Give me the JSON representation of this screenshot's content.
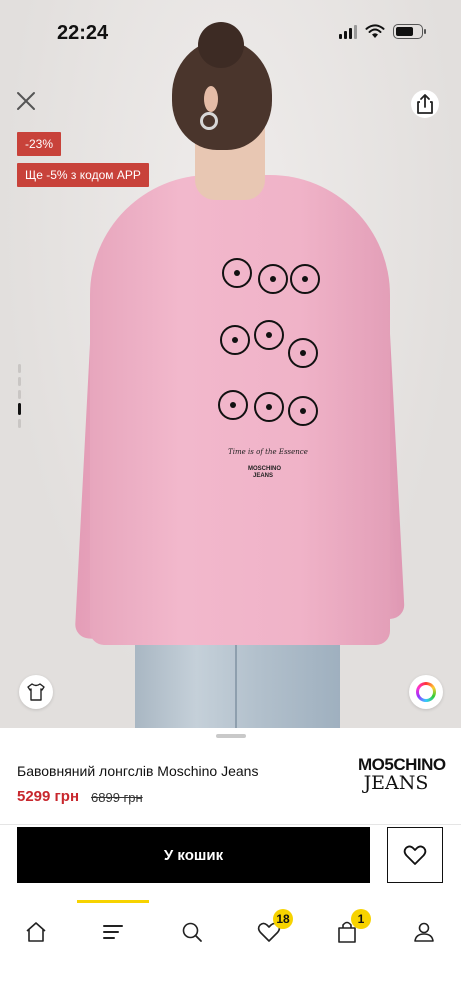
{
  "status_bar": {
    "time": "22:24",
    "signal_icon": "cellular-signal-icon",
    "wifi_icon": "wifi-icon",
    "battery_icon": "battery-icon"
  },
  "gallery": {
    "image_icon": "product-photo",
    "close_icon": "close-icon",
    "share_icon": "share-icon",
    "discount_badge": "-23%",
    "app_promo_badge": "Ще -5% з кодом APP",
    "pagination_count": 5,
    "active_index": 3,
    "tee_icon": "t-shirt-icon",
    "color_icon": "color-wheel-icon",
    "garment_script": "Time is of the Essence",
    "garment_logo_line1": "MOSCHINO",
    "garment_logo_line2": "JEANS"
  },
  "product": {
    "title": "Бавовняний лонгслів Moschino Jeans",
    "price_current": "5299 грн",
    "price_old": "6899 грн",
    "brand_logo_line1": "MO5CHINO",
    "brand_logo_line2": "JEANS",
    "add_to_cart_label": "У кошик",
    "favorite_icon": "heart-icon"
  },
  "bottom_nav": {
    "items": [
      {
        "name": "home",
        "icon": "home-icon"
      },
      {
        "name": "catalog",
        "icon": "menu-icon"
      },
      {
        "name": "search",
        "icon": "search-icon"
      },
      {
        "name": "favorites",
        "icon": "heart-icon",
        "badge": "18"
      },
      {
        "name": "cart",
        "icon": "shopping-bag-icon",
        "badge": "1"
      },
      {
        "name": "profile",
        "icon": "user-icon"
      }
    ]
  },
  "colors": {
    "accent_yellow": "#f7d300",
    "sale_red": "#c8423a",
    "price_red": "#c8272d",
    "button_black": "#000000"
  }
}
